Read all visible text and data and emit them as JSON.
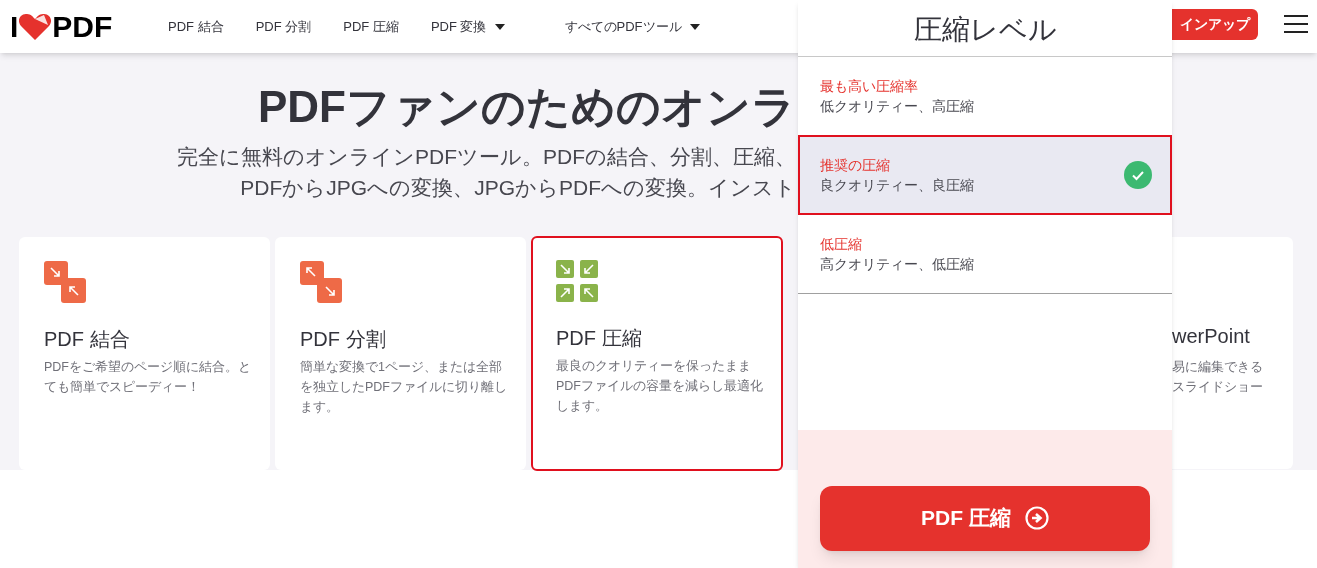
{
  "header": {
    "logo": [
      "I",
      "PDF"
    ],
    "nav": [
      {
        "label": "PDF 結合",
        "dropdown": false
      },
      {
        "label": "PDF 分割",
        "dropdown": false
      },
      {
        "label": "PDF 圧縮",
        "dropdown": false
      },
      {
        "label": "PDF 変換",
        "dropdown": true
      },
      {
        "label": "すべてのPDFツール",
        "dropdown": true
      }
    ],
    "signup_button": "インアップ"
  },
  "hero": {
    "title": "PDFファンのためのオンラ",
    "subtitle": [
      "完全に無料のオンラインPDFツール。PDFの結合、分割、圧縮、",
      "PDFからJPGへの変換、JPGからPDFへの変換。インスト"
    ]
  },
  "tools": [
    {
      "kind": "merge",
      "title": "PDF 結合",
      "description": "PDFをご希望のページ順に結合。とても簡単でスピーディー！",
      "highlighted": false
    },
    {
      "kind": "split",
      "title": "PDF 分割",
      "description": "簡単な変換で1ページ、または全部を独立したPDFファイルに切り離します。",
      "highlighted": false
    },
    {
      "kind": "compress",
      "title": "PDF 圧縮",
      "description": "最良のクオリティーを保ったままPDFファイルの容量を減らし最適化します。",
      "highlighted": true
    }
  ],
  "partial_tool": {
    "title": "werPoint",
    "description": [
      "易に編集できる",
      "スライドショー"
    ]
  },
  "compression_panel": {
    "title": "圧縮レベル",
    "options": [
      {
        "title": "最も高い圧縮率",
        "subtitle": "低クオリティー、高圧縮",
        "selected": false
      },
      {
        "title": "推奨の圧縮",
        "subtitle": "良クオリティー、良圧縮",
        "selected": true
      },
      {
        "title": "低圧縮",
        "subtitle": "高クオリティー、低圧縮",
        "selected": false
      }
    ],
    "action_button": "PDF 圧縮"
  }
}
